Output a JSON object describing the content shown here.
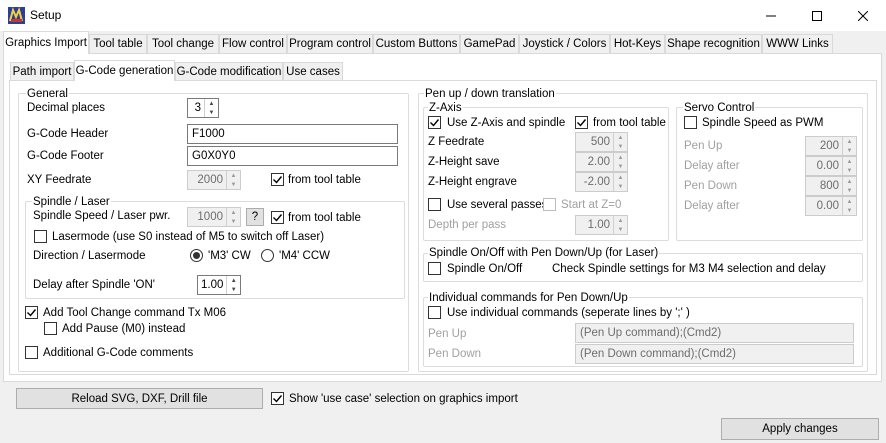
{
  "window": {
    "title": "Setup"
  },
  "main_tabs": [
    "Graphics Import",
    "Tool table",
    "Tool change",
    "Flow control",
    "Program control",
    "Custom Buttons",
    "GamePad",
    "Joystick / Colors",
    "Hot-Keys",
    "Shape recognition",
    "WWW Links"
  ],
  "sub_tabs": [
    "Path import",
    "G-Code generation",
    "G-Code modification",
    "Use cases"
  ],
  "general": {
    "title": "General",
    "decimal_places_label": "Decimal places",
    "decimal_places_value": "3",
    "header_label": "G-Code Header",
    "header_value": "F1000",
    "footer_label": "G-Code Footer",
    "footer_value": "G0X0Y0",
    "xy_feed_label": "XY Feedrate",
    "xy_feed_value": "2000",
    "xy_from_tool_table": "from tool table",
    "spindle_group": {
      "title": "Spindle / Laser",
      "speed_label": "Spindle Speed / Laser pwr.",
      "speed_value": "1000",
      "help_button": "?",
      "from_tool_table": "from tool table",
      "lasermode_label": "Lasermode (use S0 instead of M5 to switch off Laser)",
      "direction_label": "Direction / Lasermode",
      "radio_cw": "'M3' CW",
      "radio_ccw": "'M4' CCW",
      "delay_label": "Delay after Spindle 'ON'",
      "delay_value": "1.00"
    },
    "tool_change_label": "Add Tool Change command Tx M06",
    "pause_label": "Add Pause (M0) instead",
    "comments_label": "Additional G-Code comments"
  },
  "pen": {
    "title": "Pen up / down translation",
    "zaxis": {
      "title": "Z-Axis",
      "use_z_label": "Use Z-Axis and spindle",
      "from_tool_table": "from tool table",
      "feedrate_label": "Z Feedrate",
      "feedrate_value": "500",
      "height_save_label": "Z-Height save",
      "height_save_value": "2.00",
      "height_engrave_label": "Z-Height engrave",
      "height_engrave_value": "-2.00",
      "several_passes_label": "Use several passes",
      "start_at_z0_label": "Start at Z=0",
      "depth_per_pass_label": "Depth per pass",
      "depth_per_pass_value": "1.00"
    },
    "servo": {
      "title": "Servo Control",
      "pwm_label": "Spindle Speed as PWM",
      "pen_up_label": "Pen Up",
      "pen_up_value": "200",
      "delay1_label": "Delay after",
      "delay1_value": "0.00",
      "pen_down_label": "Pen Down",
      "pen_down_value": "800",
      "delay2_label": "Delay after",
      "delay2_value": "0.00"
    },
    "spindle_onoff": {
      "title": "Spindle On/Off with Pen Down/Up (for Laser)",
      "label": "Spindle On/Off",
      "note": "Check Spindle settings for M3 M4 selection and delay"
    },
    "individual": {
      "title": "Individual commands for Pen Down/Up",
      "use_label": "Use individual commands (seperate lines by ';' )",
      "pen_up_label": "Pen Up",
      "pen_up_value": "(Pen Up command);(Cmd2)",
      "pen_down_label": "Pen Down",
      "pen_down_value": "(Pen Down command);(Cmd2)"
    }
  },
  "footer": {
    "reload_button": "Reload SVG, DXF, Drill file",
    "show_use_case_label": "Show 'use case' selection on graphics import",
    "apply_button": "Apply changes"
  }
}
